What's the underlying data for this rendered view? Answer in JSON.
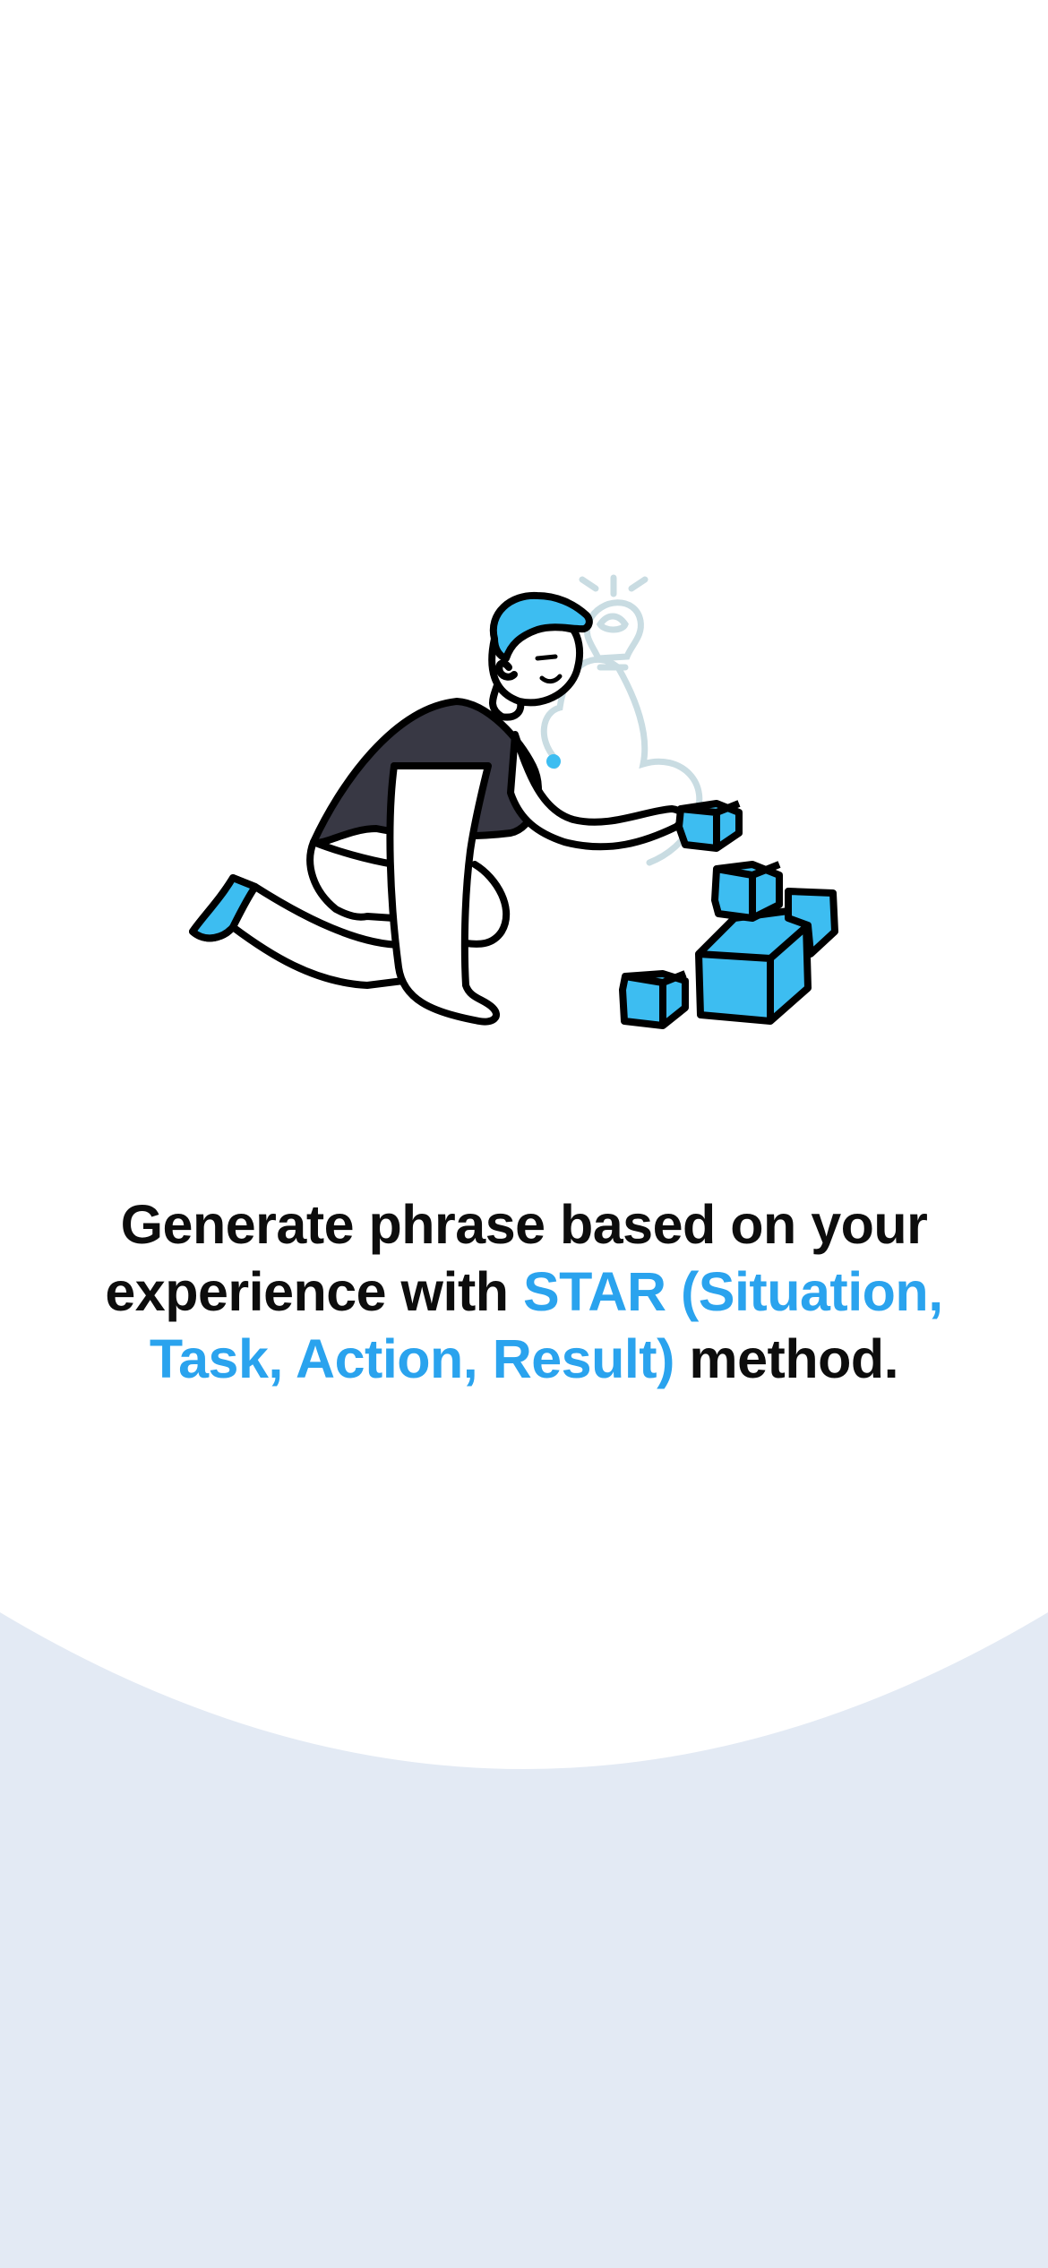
{
  "colors": {
    "accent": "#2AA3EE",
    "text": "#0d0d0d",
    "background": "#ffffff",
    "bottom_panel": "#E3EAF4",
    "cube_fill": "#3DBDF1",
    "shirt": "#383844",
    "cloud_outline": "#C9DCE2"
  },
  "illustration": {
    "icon": "person-building-blocks-illustration"
  },
  "headline": {
    "lead": "Generate phrase based on your experience with ",
    "highlight": "STAR (Situation, Task, Action, Result)",
    "trail": " method."
  }
}
